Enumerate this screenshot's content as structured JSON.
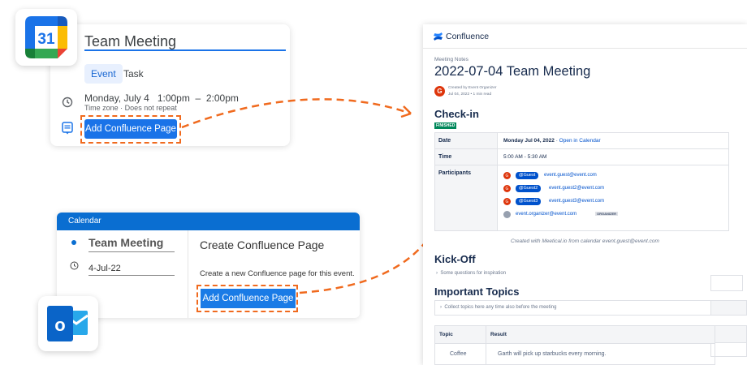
{
  "colors": {
    "google_blue": "#1a73e8",
    "outlook_blue": "#0a6ed1",
    "highlight_orange": "#f06a1e",
    "confluence_blue": "#0052cc",
    "status_green": "#00875a"
  },
  "google_calendar": {
    "icon_day": "31",
    "event_title": "Team Meeting",
    "tabs": [
      "Event",
      "Task"
    ],
    "datetime": "Monday, July 4   1:00pm  –  2:00pm",
    "timezone": "Time zone · Does not repeat",
    "add_button": "Add Confluence Page",
    "icons": [
      "clock-icon",
      "confluence-calendar-icon"
    ]
  },
  "outlook": {
    "header": "Calendar",
    "event_title": "Team Meeting",
    "date": "4-Jul-22",
    "panel_title": "Create Confluence Page",
    "panel_text": "Create a new Confluence page for this event.",
    "add_button": "Add Confluence Page",
    "logo_letter": "o"
  },
  "confluence": {
    "brand": "Confluence",
    "breadcrumb": "Meeting Notes",
    "title": "2022-07-04 Team Meeting",
    "avatar_letter": "G",
    "created_by": "Created by Event Organizer",
    "created_date": "Jul 04, 2022 •  1 min read",
    "checkin": {
      "heading": "Check-in",
      "status": "FINISHED",
      "rows": {
        "date_label": "Date",
        "date_value": "Monday Jul 04, 2022",
        "date_link": "Open in Calendar",
        "time_label": "Time",
        "time_value": "5:00 AM - 5:30 AM",
        "participants_label": "Participants"
      },
      "participants": [
        {
          "avatar": "G",
          "handle": "@Guest",
          "email": "event.guest@event.com"
        },
        {
          "avatar": "G",
          "handle": "@Guest2",
          "email": "event.guest2@event.com"
        },
        {
          "avatar": "G",
          "handle": "@Guest3",
          "email": "event.guest3@event.com"
        },
        {
          "avatar": "",
          "handle": "",
          "email": "event.organizer@event.com",
          "role": "ORGANIZER"
        }
      ]
    },
    "created_note": "Created with Meetical.io from calendar event.guest@event.com",
    "kickoff": {
      "heading": "Kick-Off",
      "expand": "Some questions for inspiration"
    },
    "topics": {
      "heading": "Important Topics",
      "expand": "Collect topics here any time also before the meeting",
      "columns": [
        "Topic",
        "Result"
      ],
      "rows": [
        {
          "topic": "Coffee",
          "result": "Garth will pick up starbucks every morning."
        }
      ]
    }
  }
}
